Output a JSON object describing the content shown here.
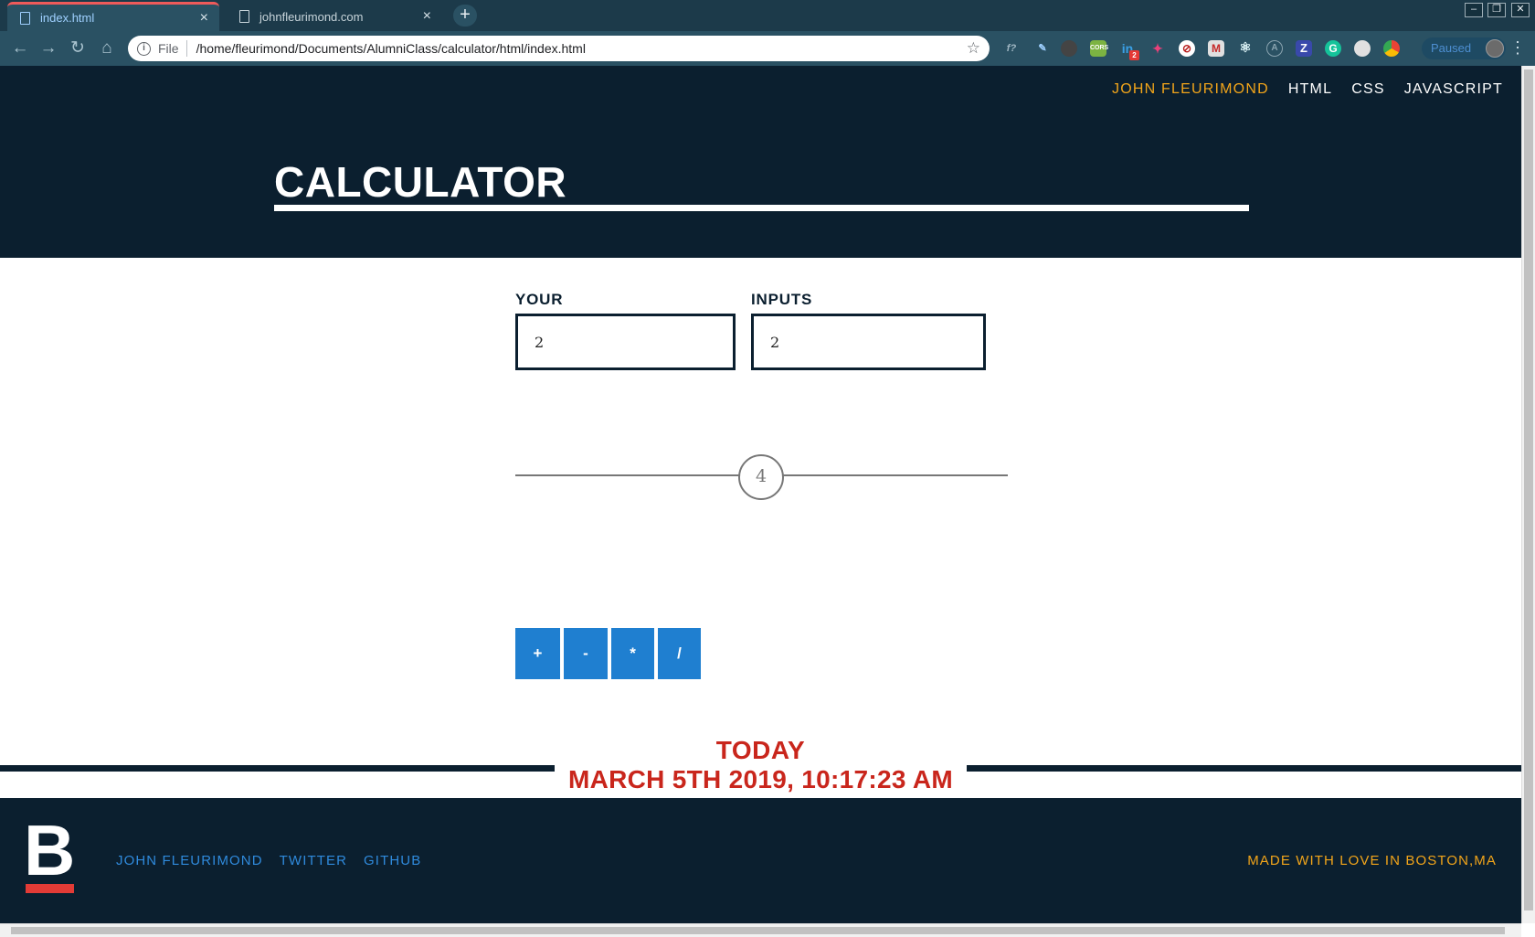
{
  "browser": {
    "tabs": [
      {
        "label": "index.html",
        "active": true
      },
      {
        "label": "johnfleurimond.com",
        "active": false
      }
    ],
    "address": {
      "scheme": "File",
      "url": "/home/fleurimond/Documents/AlumniClass/calculator/html/index.html"
    },
    "profile_status": "Paused",
    "extensions": [
      "f?",
      "pen-icon",
      "circle-icon",
      "CORS",
      "in",
      "bird-icon",
      "block-icon",
      "M",
      "react-icon",
      "A",
      "Z",
      "G",
      "bulb-icon",
      "chrome-icon"
    ],
    "extension_badge": "2"
  },
  "nav": {
    "items": [
      "JOHN FLEURIMOND",
      "HTML",
      "CSS",
      "JAVASCRIPT"
    ],
    "highlight_color": "#f2a51a"
  },
  "header": {
    "title": "CALCULATOR"
  },
  "calculator": {
    "label_left": "YOUR",
    "label_right": "INPUTS",
    "input_a": "2",
    "input_b": "2",
    "result": "4",
    "operators": [
      "+",
      "-",
      "*",
      "/"
    ],
    "button_color": "#1f7fd0"
  },
  "date": {
    "label": "TODAY",
    "value": "MARCH 5TH 2019, 10:17:23 AM",
    "color": "#c9261c"
  },
  "footer": {
    "logo_letter": "B",
    "links": [
      "JOHN FLEURIMOND",
      "TWITTER",
      "GITHUB"
    ],
    "credit": "MADE WITH LOVE IN BOSTON,MA"
  },
  "colors": {
    "navy": "#0b1f2f",
    "accent_orange": "#f2a51a",
    "link_blue": "#2f8adc",
    "logo_red": "#e33b36"
  }
}
